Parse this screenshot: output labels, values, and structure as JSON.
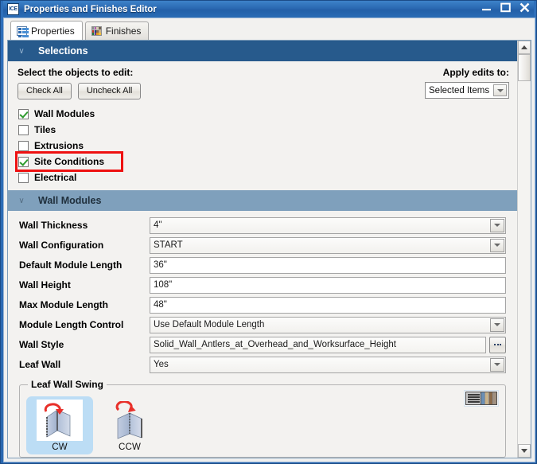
{
  "window": {
    "title": "Properties and Finishes Editor",
    "app_icon": "ICE",
    "controls": {
      "minimize": "minimize-icon",
      "maximize": "maximize-icon",
      "close": "close-icon"
    }
  },
  "tabs": [
    {
      "label": "Properties",
      "icon": "list-icon",
      "active": true
    },
    {
      "label": "Finishes",
      "icon": "color-swatch-grid-icon",
      "active": false
    }
  ],
  "selections": {
    "header": "Selections",
    "chevron": "∨",
    "prompt": "Select the objects to edit:",
    "check_all_label": "Check All",
    "uncheck_all_label": "Uncheck All",
    "apply_label": "Apply edits to:",
    "apply_value": "Selected Items",
    "items": [
      {
        "label": "Wall Modules",
        "checked": true,
        "highlighted": false
      },
      {
        "label": "Tiles",
        "checked": false,
        "highlighted": false
      },
      {
        "label": "Extrusions",
        "checked": false,
        "highlighted": false
      },
      {
        "label": "Site Conditions",
        "checked": true,
        "highlighted": true
      },
      {
        "label": "Electrical",
        "checked": false,
        "highlighted": false
      }
    ],
    "highlight_color": "#ee1111"
  },
  "wall_modules": {
    "header": "Wall Modules",
    "chevron": "∨",
    "fields": [
      {
        "label": "Wall Thickness",
        "value": "4\"",
        "type": "combo"
      },
      {
        "label": "Wall Configuration",
        "value": "START",
        "type": "combo"
      },
      {
        "label": "Default Module Length",
        "value": "36\"",
        "type": "text"
      },
      {
        "label": "Wall Height",
        "value": "108\"",
        "type": "text"
      },
      {
        "label": "Max Module Length",
        "value": "48\"",
        "type": "text"
      },
      {
        "label": "Module Length Control",
        "value": "Use Default Module Length",
        "type": "combo"
      },
      {
        "label": "Wall Style",
        "value": "Solid_Wall_Antlers_at_Overhead_and_Worksurface_Height",
        "type": "browse",
        "browse_label": "..."
      },
      {
        "label": "Leaf Wall",
        "value": "Yes",
        "type": "combo"
      }
    ],
    "leaf_wall_swing": {
      "legend": "Leaf Wall Swing",
      "options": [
        {
          "label": "CW",
          "icon": "wall-swing-cw-icon",
          "selected": true
        },
        {
          "label": "CCW",
          "icon": "wall-swing-ccw-icon",
          "selected": false
        }
      ],
      "preview_toggle_icon": "list-and-swatch-preview-icon"
    }
  },
  "colors": {
    "titlebar": "#2a68b0",
    "section_header_dark": "#275a8c",
    "section_header_light": "#7fa0bc",
    "panel_bg": "#f3f2f0",
    "selection_highlight": "#bcddf5",
    "check_green": "#2e9b2e"
  }
}
